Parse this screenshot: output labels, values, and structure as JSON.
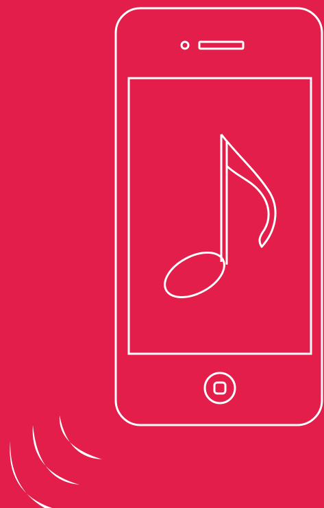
{
  "colors": {
    "background": "#E31E4B",
    "foreground": "#FFFFFF"
  },
  "icons": {
    "phone": "smartphone-icon",
    "note": "music-note-icon",
    "sound": "sound-waves-icon"
  }
}
